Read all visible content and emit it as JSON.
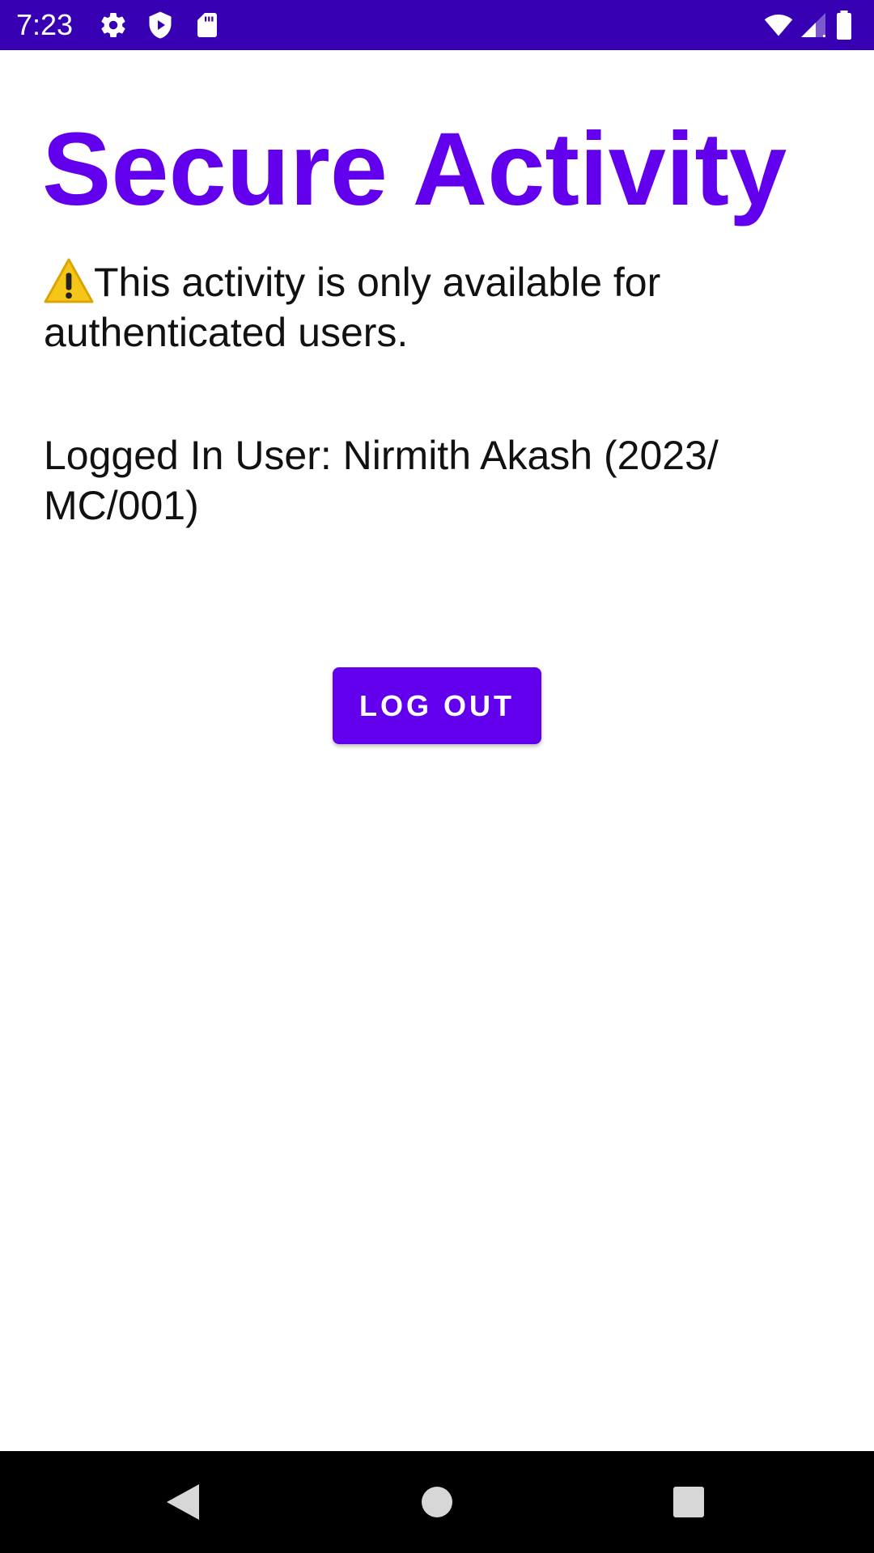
{
  "status_bar": {
    "time": "7:23",
    "background_color": "#3700B3",
    "left_icons": [
      "gear-icon",
      "shield-play-icon",
      "sd-card-icon"
    ],
    "right_icons": [
      "wifi-icon",
      "cellular-signal-icon",
      "battery-icon"
    ]
  },
  "main": {
    "title": "Secure Activity",
    "title_color": "#6200EE",
    "warning_icon": "warning-icon",
    "warning_text": "This activity is only available for authenticated users.",
    "user_text": "Logged In User: Nirmith Akash (2023/ MC/001)"
  },
  "actions": {
    "logout_label": "LOG OUT",
    "button_color": "#6200EE"
  },
  "nav_bar": {
    "buttons": [
      "back-icon",
      "home-icon",
      "recents-icon"
    ]
  }
}
